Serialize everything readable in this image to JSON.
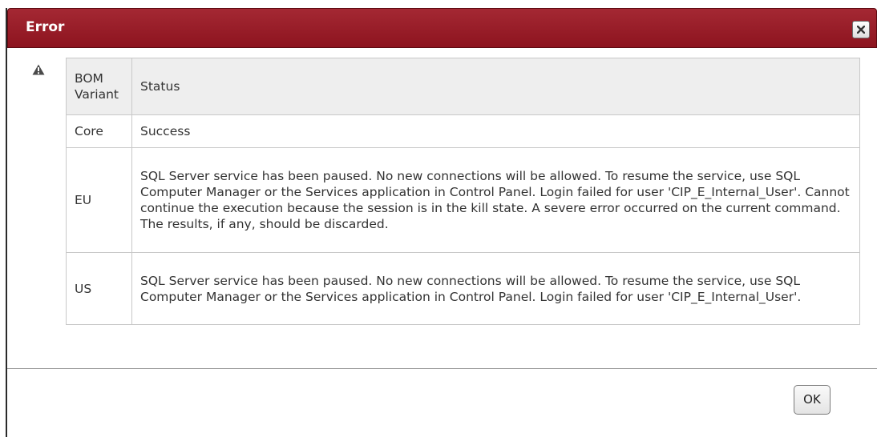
{
  "dialog": {
    "title": "Error",
    "close_icon": "close-icon",
    "warning_icon": "warning-icon",
    "ok_label": "OK"
  },
  "table": {
    "headers": [
      "BOM\nVariant",
      "Status"
    ],
    "rows": [
      {
        "variant": "Core",
        "status": "Success"
      },
      {
        "variant": "EU",
        "status": "SQL Server service has been paused. No new connections will be allowed. To resume the service, use SQL Computer Manager or the Services application in Control Panel. Login failed for user 'CIP_E_Internal_User'. Cannot continue the execution because the session is in the kill state. A severe error occurred on the current command. The results, if any, should be discarded."
      },
      {
        "variant": "US",
        "status": "SQL Server service has been paused. No new connections will be allowed. To resume the service, use SQL Computer Manager or the Services application in Control Panel. Login failed for user 'CIP_E_Internal_User'."
      }
    ]
  },
  "colors": {
    "titlebar": "#9b1e29",
    "border": "#c8c8c8",
    "header_bg": "#eeeeee"
  }
}
